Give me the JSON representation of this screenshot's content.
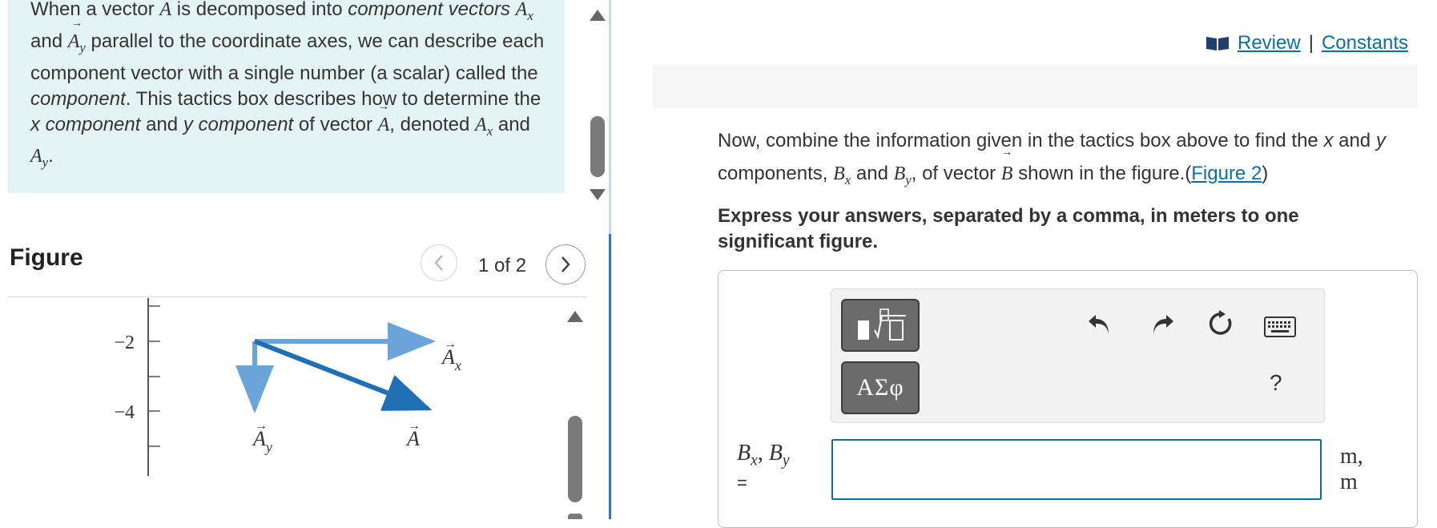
{
  "tactics": {
    "line1_pre": "When a vector ",
    "line1_var": "A",
    "line1_mid": " is decomposed into ",
    "line1_em": "component",
    "line2_em": "vectors",
    "line2_and": " and ",
    "line2_post": " parallel to the coordinate axes, we can describe each component vector with a single number (a scalar) called the ",
    "line2_em2": "component",
    "line3": ". This tactics box describes how to determine the ",
    "x_comp": "x component",
    "and_y": " and ",
    "y_comp": "y component",
    "of_vector": " of vector ",
    "denoted": ", denoted ",
    "and": " and ",
    "period": ".",
    "vec_A": "A",
    "sub_x": "x",
    "sub_y": "y"
  },
  "figure": {
    "title": "Figure",
    "counter": "1 of 2",
    "tick_labels": [
      "−2",
      "−4"
    ],
    "label_Ax": "A",
    "label_Ax_sub": "x",
    "label_Ay": "A",
    "label_Ay_sub": "y",
    "label_A": "A"
  },
  "links": {
    "review": "Review",
    "separator": "|",
    "constants": "Constants"
  },
  "question": {
    "text1": "Now, combine the information given in the tactics box above to find the ",
    "x": "x",
    "text2": " and ",
    "y": "y",
    "text3": " components, ",
    "Bx": "B",
    "and": " and ",
    "By": "B",
    "text4": ", of vector ",
    "B": "B",
    "text5": " shown in the figure.(",
    "figure_link": "Figure 2",
    "close": ")",
    "sub_x": "x",
    "sub_y": "y"
  },
  "instructions": "Express your answers, separated by a comma, in meters to one significant figure.",
  "toolbar": {
    "symbols_label": "ΑΣφ",
    "help_label": "?"
  },
  "answer": {
    "label_B": "B",
    "label_comma": ", ",
    "label_sub_x": "x",
    "label_sub_y": "y",
    "equals": "=",
    "value": "",
    "unit_line1": "m,",
    "unit_line2": "m"
  },
  "colors": {
    "tactics_bg": "#e4f4f4",
    "link": "#0b6fa4",
    "input_border": "#0d6fa0",
    "vector_dark": "#1f6fb5",
    "vector_light": "#6aa4d8"
  }
}
